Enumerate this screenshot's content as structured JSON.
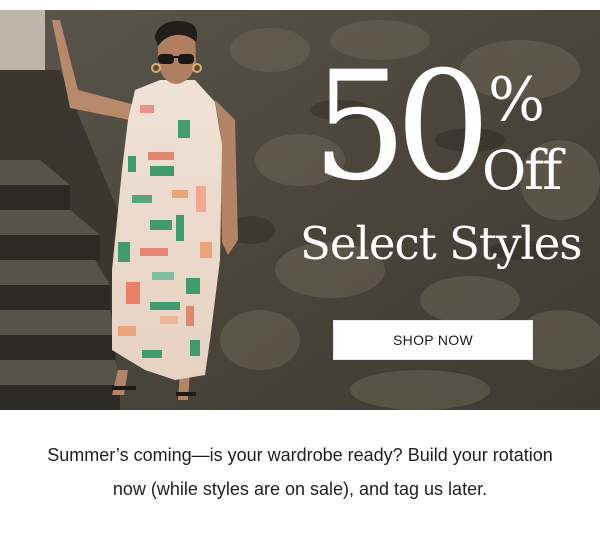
{
  "hero": {
    "headline_number": "50",
    "headline_percent": "%",
    "headline_off": "Off",
    "headline_subtitle": "Select Styles",
    "cta_label": "SHOP NOW",
    "image_description": "hero-photo-model-in-geometric-print-dress"
  },
  "body": {
    "line1": "Summer’s coming—is your wardrobe ready? Build your rotation",
    "line2": "now (while styles are on sale), and tag us later."
  },
  "colors": {
    "hero_text": "#ffffff",
    "button_bg": "#ffffff",
    "button_text": "#1c1c1c",
    "body_text": "#1f1f1f",
    "page_bg": "#ffffff"
  }
}
